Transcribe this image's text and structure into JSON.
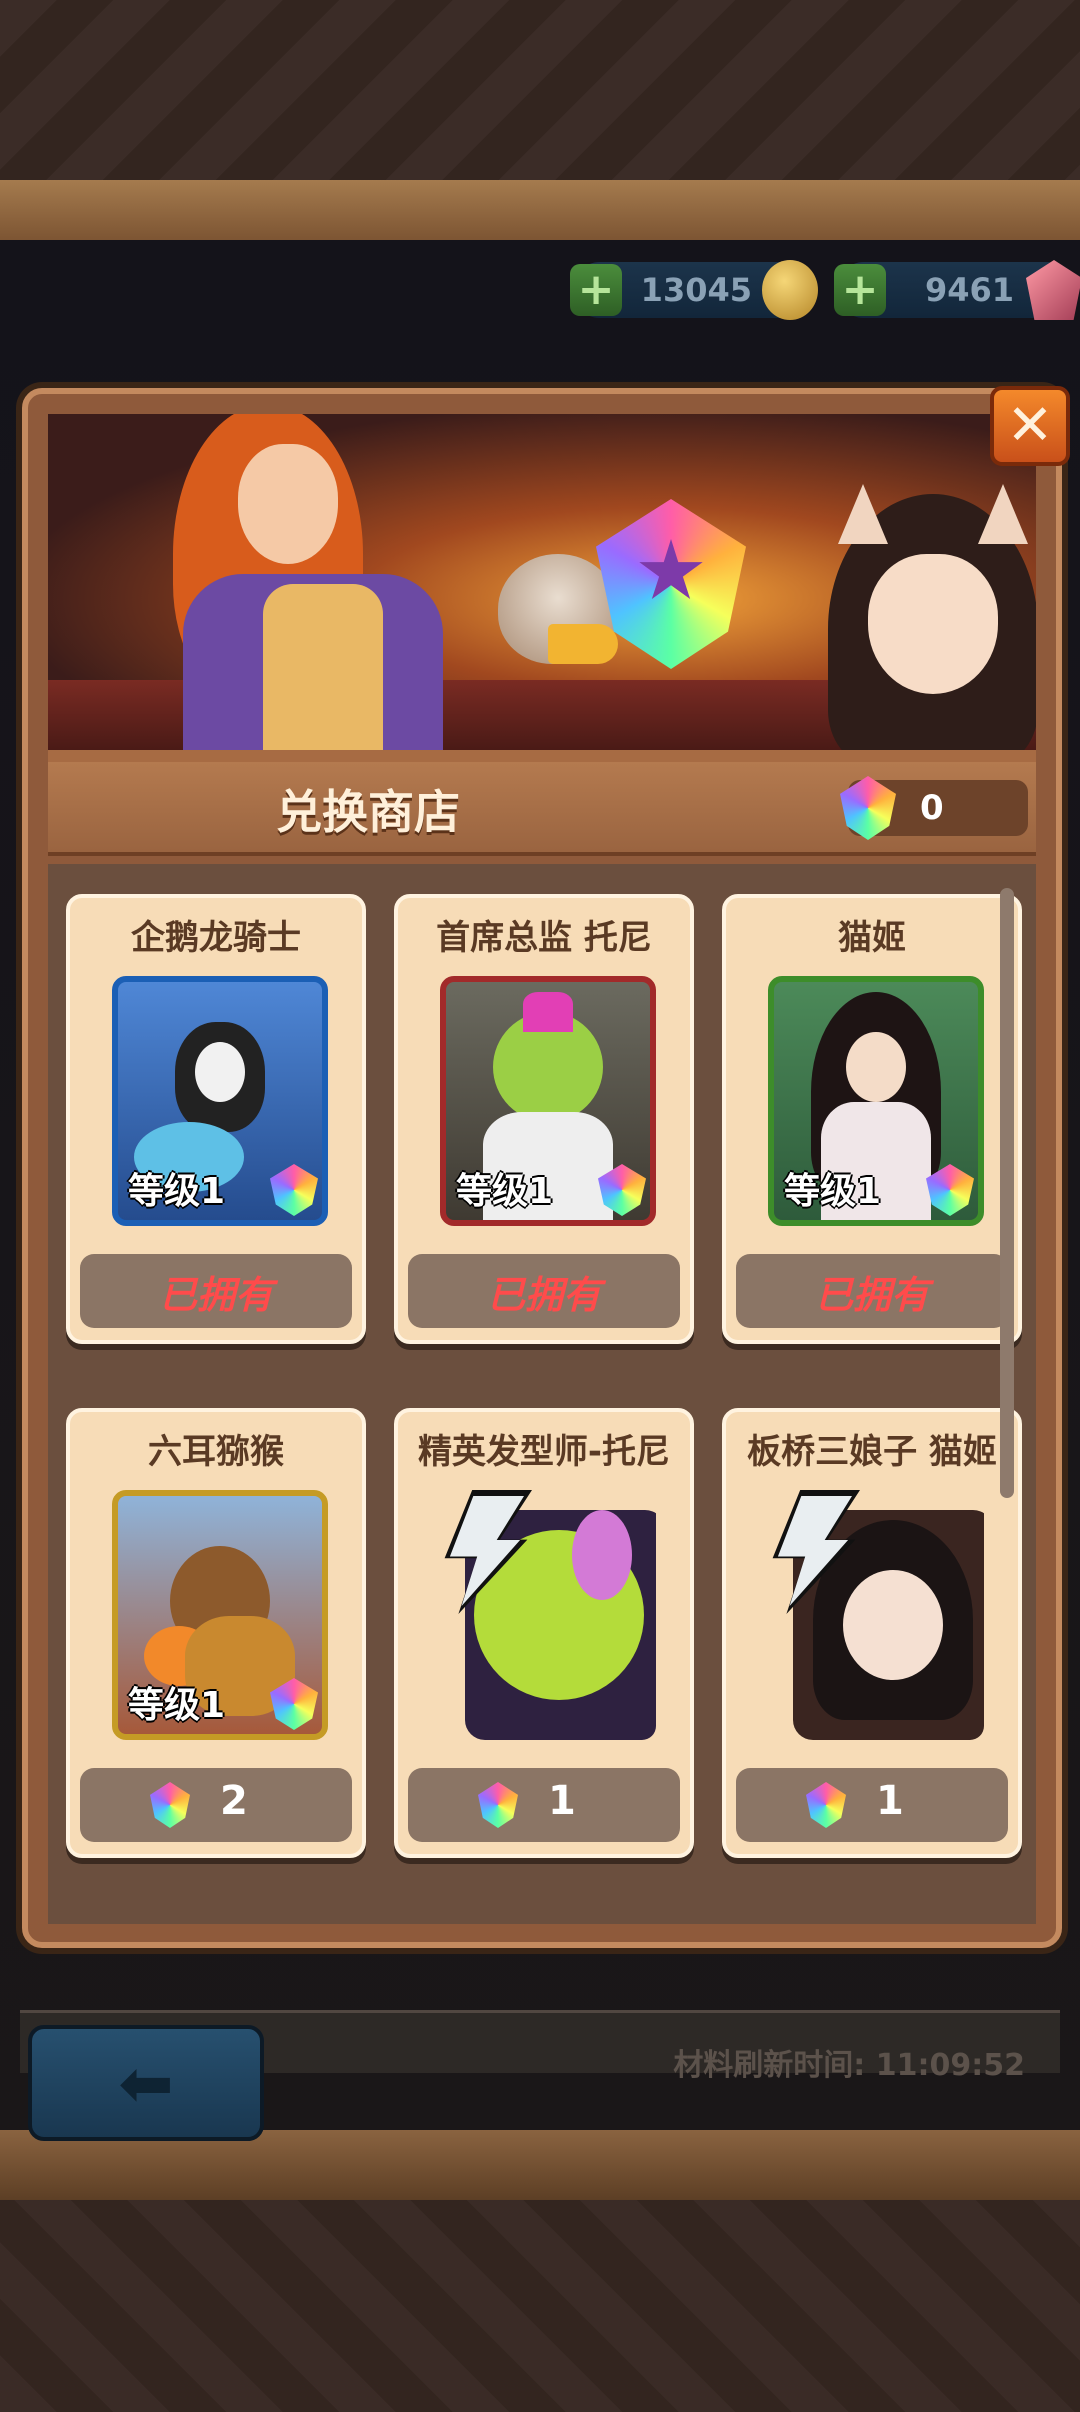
{
  "currency": {
    "gold_amount": "13045",
    "gem_amount": "9461"
  },
  "shop": {
    "title": "兑换商店",
    "token_count": "0"
  },
  "items": [
    {
      "name": "企鹅龙骑士",
      "level": "等级1",
      "status": "已拥有",
      "frame": "blue"
    },
    {
      "name": "首席总监 托尼",
      "level": "等级1",
      "status": "已拥有",
      "frame": "red"
    },
    {
      "name": "猫姬",
      "level": "等级1",
      "status": "已拥有",
      "frame": "green"
    },
    {
      "name": "六耳猕猴",
      "level": "等级1",
      "price": "2",
      "frame": "gold"
    },
    {
      "name": "精英发型师-托尼",
      "price": "1",
      "frame": "skin"
    },
    {
      "name": "板桥三娘子 猫姬",
      "price": "1",
      "frame": "skin"
    }
  ],
  "footer": {
    "refresh_text": "材料刷新时间: 11:09:52"
  },
  "icons": {
    "close": "close-icon",
    "back": "back-arrow-icon",
    "plus": "plus-icon",
    "gold": "gold-coin-icon",
    "gem": "red-gem-icon",
    "token": "exchange-token-icon"
  }
}
